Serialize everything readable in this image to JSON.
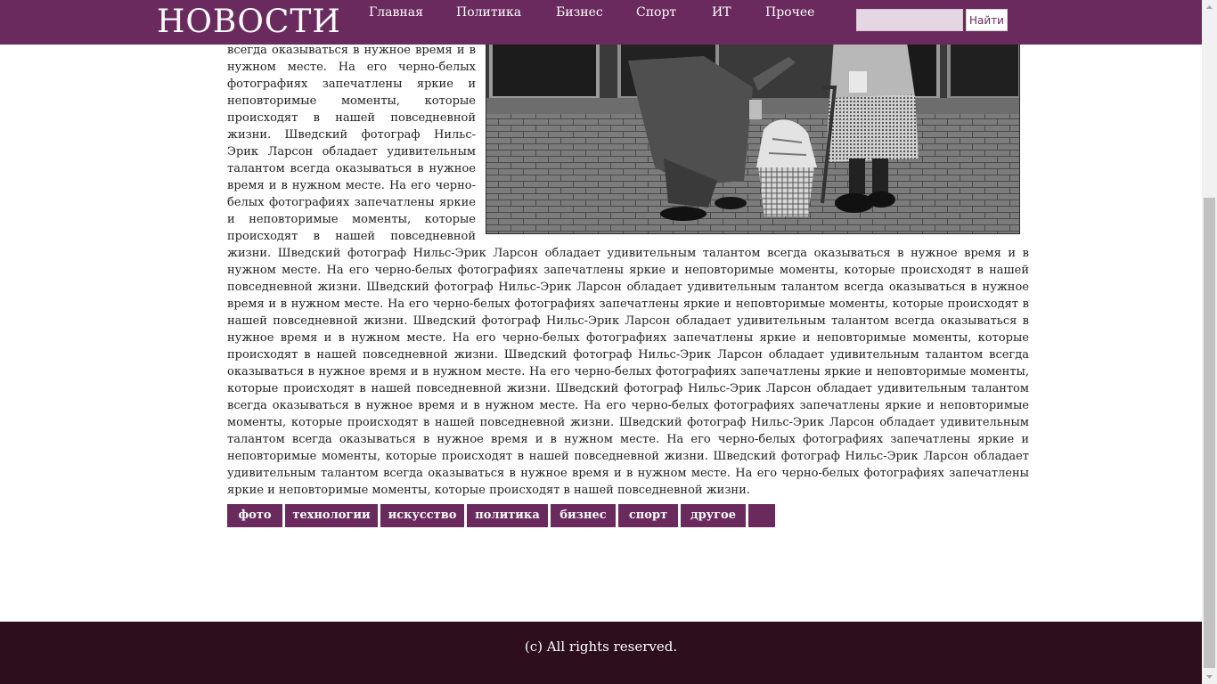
{
  "header": {
    "logo": "НОВОСТИ",
    "nav": [
      "Главная",
      "Политика",
      "Бизнес",
      "Спорт",
      "ИТ",
      "Прочее"
    ],
    "search": {
      "placeholder": "",
      "value": "",
      "button_label": "Найти"
    }
  },
  "article": {
    "paragraph": "обладает удивительным талантом всегда оказываться в нужное время и в нужном месте. На его черно-белых фотографиях запечатлены яркие и неповторимые моменты, которые происходят в нашей повседневной жизни. Шведский фотограф Нильс-Эрик Ларсон обладает удивительным талантом всегда оказываться в нужное время и в нужном месте. На его черно-белых фотографиях запечатлены яркие и неповторимые моменты, которые происходят в нашей повседневной жизни. Шведский фотограф Нильс-Эрик Ларсон обладает удивительным талантом всегда оказываться в нужное время и в нужном месте. На его черно-белых фотографиях запечатлены яркие и неповторимые моменты, которые происходят в нашей повседневной жизни. Шведский фотограф Нильс-Эрик Ларсон обладает удивительным талантом всегда оказываться в нужное время и в нужном месте. На его черно-белых фотографиях запечатлены яркие и неповторимые моменты, которые происходят в нашей повседневной жизни. Шведский фотограф Нильс-Эрик Ларсон обладает удивительным талантом всегда оказываться в нужное время и в нужном месте. На его черно-белых фотографиях запечатлены яркие и неповторимые моменты, которые происходят в нашей повседневной жизни. Шведский фотограф Нильс-Эрик Ларсон обладает удивительным талантом всегда оказываться в нужное время и в нужном месте. На его черно-белых фотографиях запечатлены яркие и неповторимые моменты, которые происходят в нашей повседневной жизни. Шведский фотограф Нильс-Эрик Ларсон обладает удивительным талантом всегда оказываться в нужное время и в нужном месте. На его черно-белых фотографиях запечатлены яркие и неповторимые моменты, которые происходят в нашей повседневной жизни. Шведский фотограф Нильс-Эрик Ларсон обладает удивительным талантом всегда оказываться в нужное время и в нужном месте. На его черно-белых фотографиях запечатлены яркие и неповторимые моменты, которые происходят в нашей повседневной жизни. Шведский фотограф Нильс-Эрик Ларсон обладает удивительным талантом всегда оказываться в нужное время и в нужном месте. На его черно-белых фотографиях запечатлены яркие и неповторимые моменты, которые происходят в нашей повседневной жизни."
  },
  "tags": [
    "фото",
    "технологии",
    "искусство",
    "политика",
    "бизнес",
    "спорт",
    "другое",
    ""
  ],
  "footer": {
    "copyright": "(c) All rights reserved."
  },
  "colors": {
    "accent": "#6a2a5e",
    "footer": "#2c0e1c",
    "search_field": "#e4d7e3"
  }
}
